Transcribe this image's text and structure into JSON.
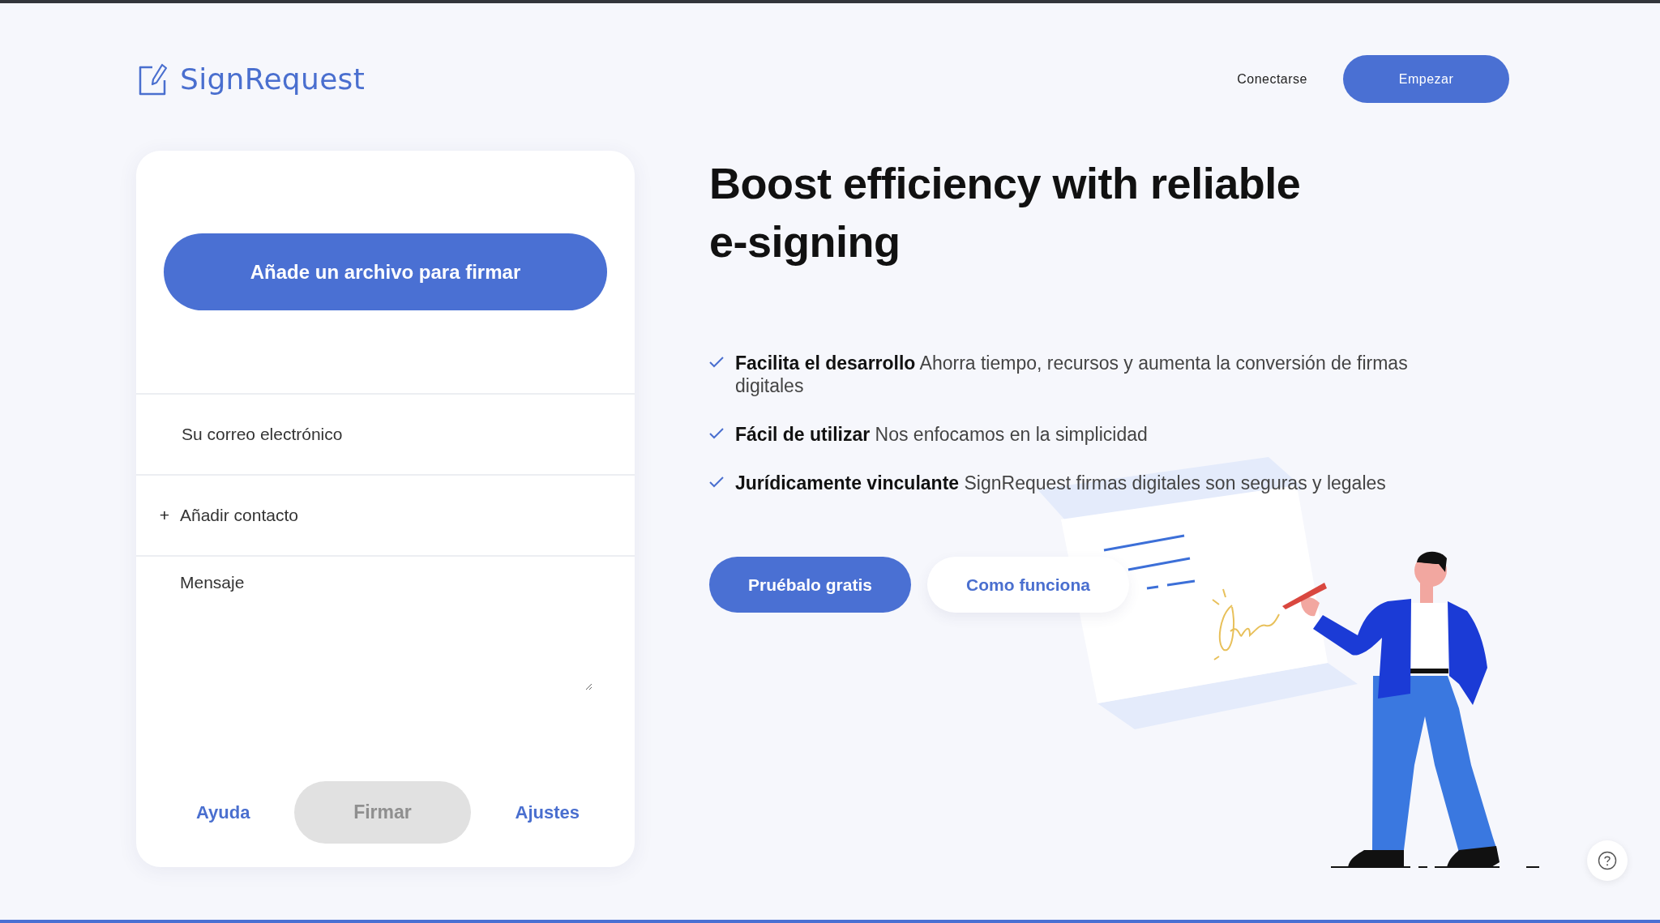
{
  "logo": {
    "text": "SignRequest"
  },
  "nav": {
    "login": "Conectarse",
    "cta": "Empezar"
  },
  "card": {
    "upload_button": "Añade un archivo para firmar",
    "email": {
      "placeholder": "Su correo electrónico"
    },
    "add_contact": {
      "icon": "+",
      "label": "Añadir contacto"
    },
    "message": {
      "placeholder": "Mensaje"
    },
    "footer": [
      {
        "label": "Ayuda",
        "kind": "link"
      },
      {
        "label": "Firmar",
        "kind": "button",
        "disabled": true
      },
      {
        "label": "Ajustes",
        "kind": "link"
      }
    ]
  },
  "hero": {
    "heading": "Boost efficiency with reliable e-signing",
    "features": [
      {
        "title": "Facilita el desarrollo",
        "text": "Ahorra tiempo, recursos y aumenta la conversión de firmas digitales"
      },
      {
        "title": "Fácil de utilizar",
        "text": "Nos enfocamos en la simplicidad"
      },
      {
        "title": "Jurídicamente vinculante",
        "text": "SignRequest firmas digitales son seguras y legales"
      }
    ],
    "buttons": [
      {
        "label": "Pruébalo gratis",
        "kind": "primary"
      },
      {
        "label": "Como funciona",
        "kind": "secondary"
      }
    ]
  }
}
